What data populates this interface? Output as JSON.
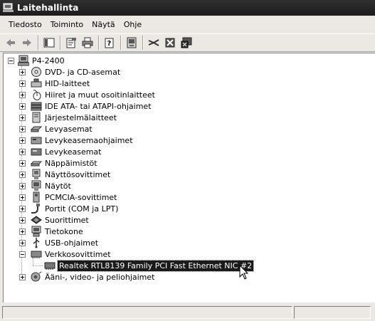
{
  "window": {
    "title": "Laitehallinta"
  },
  "menu": [
    "Tiedosto",
    "Toiminto",
    "Näytä",
    "Ohje"
  ],
  "toolbar": [
    "back-icon",
    "forward-icon",
    "show-hide-tree-icon",
    "properties-icon",
    "print-icon",
    "help-icon",
    "scan-hardware-icon",
    "update-driver-icon",
    "uninstall-icon",
    "disable-icon"
  ],
  "tree": {
    "root": "P4-2400",
    "items": [
      {
        "label": "DVD- ja CD-asemat",
        "icon": "cd-drive-icon"
      },
      {
        "label": "HID-laitteet",
        "icon": "hid-icon"
      },
      {
        "label": "Hiiret ja muut osoitinlaitteet",
        "icon": "mouse-icon"
      },
      {
        "label": "IDE ATA- tai ATAPI-ohjaimet",
        "icon": "ide-controller-icon"
      },
      {
        "label": "Järjestelmälaitteet",
        "icon": "system-device-icon"
      },
      {
        "label": "Levyasemat",
        "icon": "floppy-drive-icon"
      },
      {
        "label": "Levykeasemaohjaimet",
        "icon": "floppy-controller-icon"
      },
      {
        "label": "Levykeasemat",
        "icon": "disk-drive-icon"
      },
      {
        "label": "Näppäimistöt",
        "icon": "keyboard-icon"
      },
      {
        "label": "Näyttösovittimet",
        "icon": "display-adapter-icon"
      },
      {
        "label": "Näytöt",
        "icon": "monitor-icon"
      },
      {
        "label": "PCMCIA-sovittimet",
        "icon": "pcmcia-icon"
      },
      {
        "label": "Portit (COM ja LPT)",
        "icon": "port-icon"
      },
      {
        "label": "Suorittimet",
        "icon": "processor-icon"
      },
      {
        "label": "Tietokone",
        "icon": "computer-icon"
      },
      {
        "label": "USB-ohjaimet",
        "icon": "usb-icon"
      },
      {
        "label": "Verkkosovittimet",
        "icon": "network-adapter-icon",
        "expanded": true,
        "children": [
          {
            "label": "Realtek RTL8139 Family PCI Fast Ethernet NIC #2",
            "icon": "network-card-icon",
            "selected": true
          }
        ]
      },
      {
        "label": "Ääni-, video- ja peliohjaimet",
        "icon": "sound-icon"
      }
    ]
  },
  "statusbar": {
    "left": "",
    "right": ""
  }
}
